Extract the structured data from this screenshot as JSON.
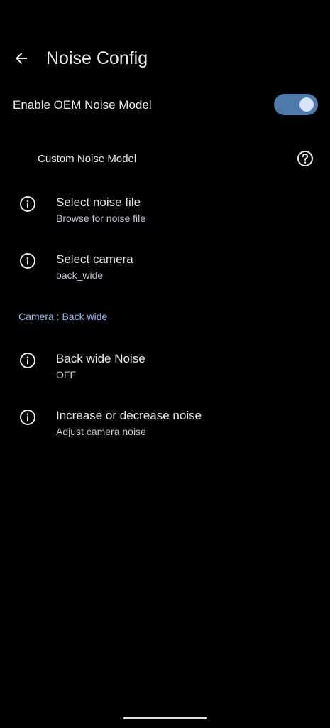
{
  "header": {
    "title": "Noise Config",
    "back_icon": "arrow-back-icon"
  },
  "oem_toggle": {
    "label": "Enable OEM Noise Model",
    "enabled": true,
    "track_color": "#4e79a8",
    "thumb_color": "#d7e3ff"
  },
  "custom_section": {
    "title": "Custom Noise Model",
    "help_icon": "help-circle-icon",
    "items": [
      {
        "title": "Select noise file",
        "summary": "Browse for noise file",
        "icon": "info-icon"
      },
      {
        "title": "Select camera",
        "summary": "back_wide",
        "icon": "info-icon"
      }
    ]
  },
  "camera_section": {
    "title": "Camera : Back wide",
    "accent_color": "#9fbaf0",
    "items": [
      {
        "title": "Back wide Noise",
        "summary": "OFF",
        "icon": "info-icon"
      },
      {
        "title": "Increase or decrease noise",
        "summary": "Adjust camera noise",
        "icon": "info-icon"
      }
    ]
  },
  "theme": {
    "background": "#000000",
    "text_primary": "#e8eaed",
    "text_secondary": "#c5c9d0"
  }
}
